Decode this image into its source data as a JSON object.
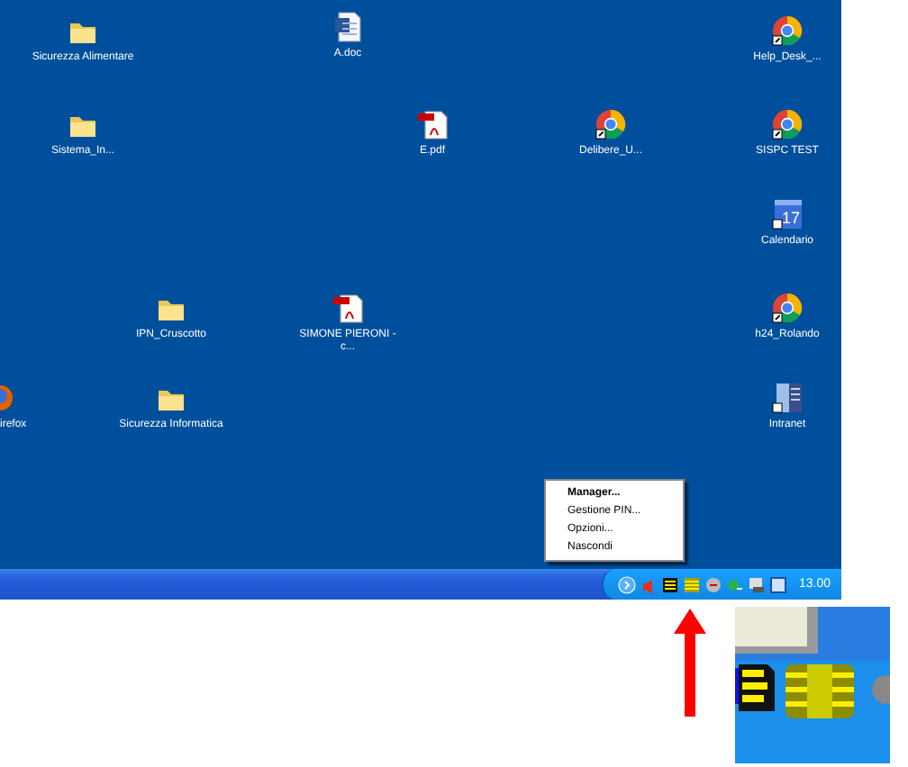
{
  "desktop": {
    "icons": [
      {
        "label": "Sicurezza Alimentare",
        "kind": "folder"
      },
      {
        "label": "A.doc",
        "kind": "word"
      },
      {
        "label": "Help_Desk_...",
        "kind": "chrome"
      },
      {
        "label": "Sistema_In...",
        "kind": "folder"
      },
      {
        "label": "E.pdf",
        "kind": "pdf"
      },
      {
        "label": "Delibere_U...",
        "kind": "chrome"
      },
      {
        "label": "SISPC TEST",
        "kind": "chrome"
      },
      {
        "label": "Calendario",
        "kind": "calendar",
        "day": "17"
      },
      {
        "label": "IPN_Cruscotto",
        "kind": "folder"
      },
      {
        "label": "SIMONE PIERONI - c...",
        "kind": "pdf"
      },
      {
        "label": "h24_Rolando",
        "kind": "chrome"
      },
      {
        "label": "irefox",
        "kind": "firefox"
      },
      {
        "label": "Sicurezza Informatica",
        "kind": "folder"
      },
      {
        "label": "Intranet",
        "kind": "intranet"
      }
    ]
  },
  "context_menu": {
    "items": [
      {
        "label": "Manager...",
        "default": true
      },
      {
        "label": "Gestione PIN...",
        "default": false
      },
      {
        "label": "Opzioni...",
        "default": false
      },
      {
        "label": "Nascondi",
        "default": false
      }
    ]
  },
  "taskbar": {
    "clock": "13.00"
  }
}
